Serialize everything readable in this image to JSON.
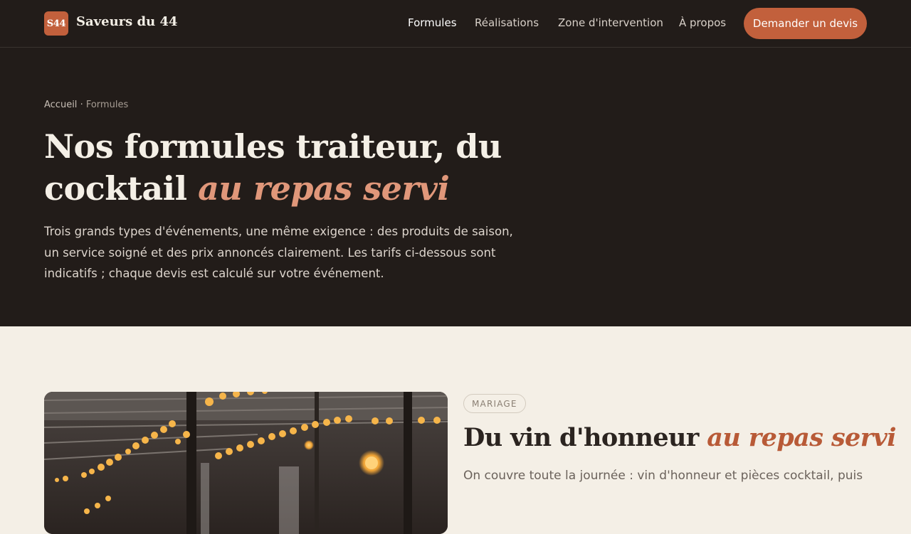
{
  "header": {
    "logo_text": "S44",
    "brand": "Saveurs du 44",
    "nav": [
      "Formules",
      "Réalisations",
      "Zone d'intervention",
      "À propos"
    ],
    "active_nav": "Formules",
    "cta_label": "Demander un devis"
  },
  "hero": {
    "breadcrumb": {
      "home": "Accueil",
      "separator": "·",
      "current": "Formules"
    },
    "title_main": "Nos formules traiteur, du cocktail",
    "title_accent": "au repas servi",
    "lead": "Trois grands types d'événements, une même exigence : des produits de saison, un service soigné et des prix annoncés clairement. Les tarifs ci-dessous sont indicatifs ; chaque devis est calculé sur votre événement."
  },
  "formula": {
    "tag": "MARIAGE",
    "title_main": "Du vin d'honneur",
    "title_accent": "au repas servi",
    "lead": "On couvre toute la journée : vin d'honneur et pièces cocktail, puis"
  },
  "colors": {
    "dark_bg": "#221c19",
    "cream_bg": "#f4efe6",
    "accent": "#c2603c",
    "hero_accent": "#e0977a"
  }
}
